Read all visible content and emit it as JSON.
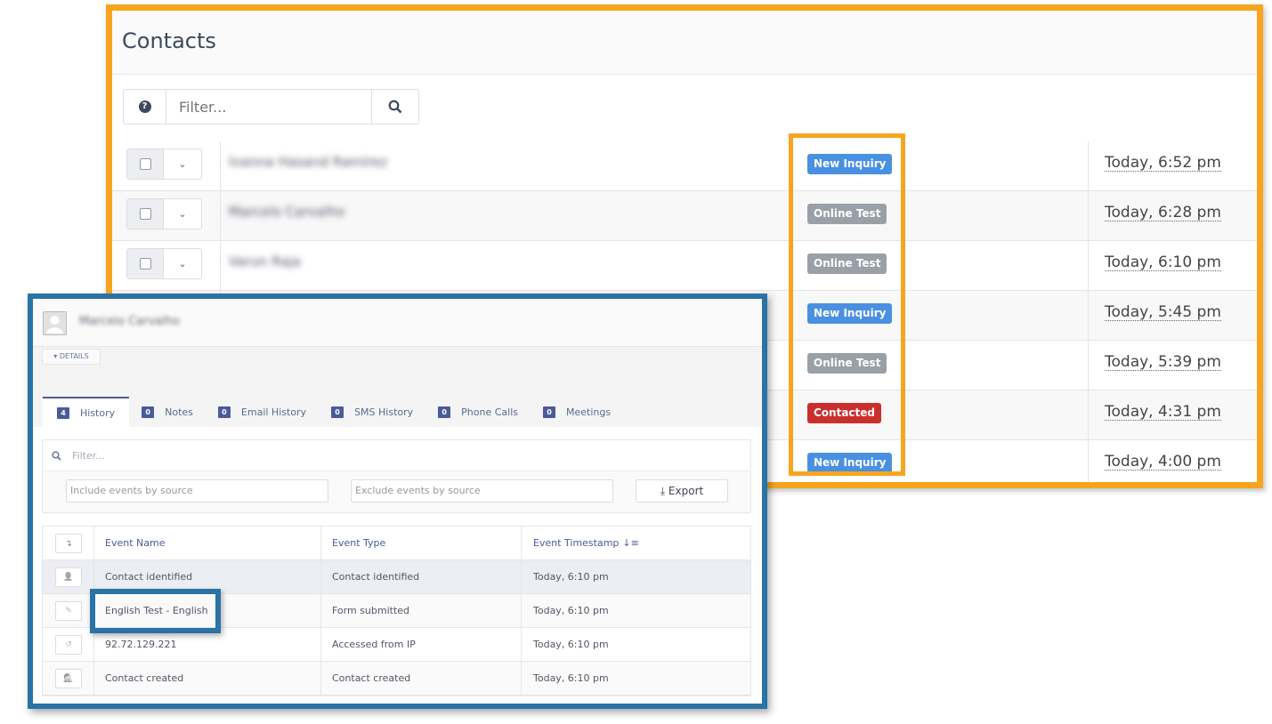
{
  "contacts": {
    "title": "Contacts",
    "filter_placeholder": "Filter...",
    "rows": [
      {
        "name": "Ivanna Hasand Ramirez",
        "status": "New Inquiry",
        "time": "Today, 6:52 pm"
      },
      {
        "name": "Marcelo Carvalho",
        "status": "Online Test",
        "time": "Today, 6:28 pm"
      },
      {
        "name": "Varun Raja",
        "status": "Online Test",
        "time": "Today, 6:10 pm"
      },
      {
        "name": "",
        "status": "New Inquiry",
        "time": "Today, 5:45 pm"
      },
      {
        "name": "",
        "status": "Online Test",
        "time": "Today, 5:39 pm"
      },
      {
        "name": "",
        "status": "Contacted",
        "time": "Today, 4:31 pm"
      },
      {
        "name": "",
        "status": "New Inquiry",
        "time": "Today, 4:00 pm"
      }
    ],
    "status_colors": {
      "New Inquiry": "#4A90E2",
      "Online Test": "#9AA0A8",
      "Contacted": "#C9302C"
    }
  },
  "detail": {
    "contact_name": "Marcelo Carvalho",
    "details_label": "DETAILS",
    "tabs": [
      {
        "count": "4",
        "label": "History"
      },
      {
        "count": "0",
        "label": "Notes"
      },
      {
        "count": "0",
        "label": "Email History"
      },
      {
        "count": "0",
        "label": "SMS History"
      },
      {
        "count": "0",
        "label": "Phone Calls"
      },
      {
        "count": "0",
        "label": "Meetings"
      }
    ],
    "filter_placeholder": "Filter...",
    "include_placeholder": "Include events by source",
    "exclude_placeholder": "Exclude events by source",
    "export_label": "Export",
    "columns": [
      "Event Name",
      "Event Type",
      "Event Timestamp"
    ],
    "events": [
      {
        "icon": "user-icon",
        "name": "Contact identified",
        "type": "Contact identified",
        "time": "Today, 6:10 pm"
      },
      {
        "icon": "edit-icon",
        "name": "English Test - English",
        "type": "Form submitted",
        "time": "Today, 6:10 pm"
      },
      {
        "icon": "history-icon",
        "name": "92.72.129.221",
        "type": "Accessed from IP",
        "time": "Today, 6:10 pm"
      },
      {
        "icon": "user-secret-icon",
        "name": "Contact created",
        "type": "Contact created",
        "time": "Today, 6:10 pm"
      }
    ]
  },
  "highlight_colors": {
    "orange": "#F7A51E",
    "blue": "#2A73A6"
  }
}
